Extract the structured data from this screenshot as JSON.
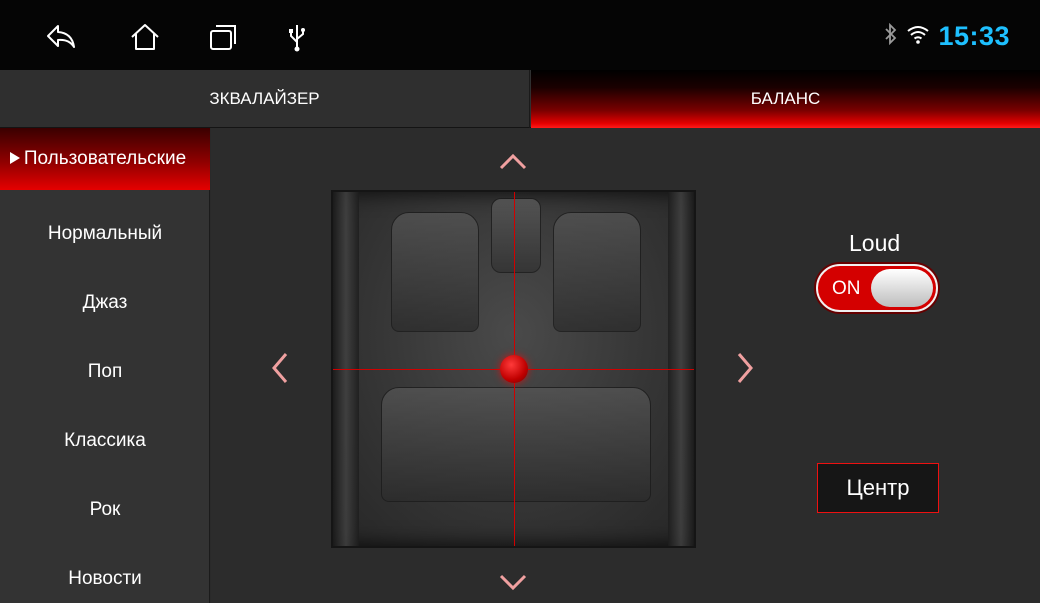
{
  "statusbar": {
    "nav_icons": [
      "back-icon",
      "home-icon",
      "recent-apps-icon",
      "usb-icon"
    ],
    "status_icons": [
      "bluetooth-icon",
      "wifi-icon"
    ],
    "time": "15:33",
    "time_color": "#1ec0ff"
  },
  "tabs": [
    {
      "label": "ЗКВАЛАЙЗЕР",
      "active": false
    },
    {
      "label": "БАЛАНС",
      "active": true
    }
  ],
  "presets": [
    {
      "label": "Пользовательские",
      "active": true
    },
    {
      "label": "Нормальный",
      "active": false
    },
    {
      "label": "Джаз",
      "active": false
    },
    {
      "label": "Поп",
      "active": false
    },
    {
      "label": "Классика",
      "active": false
    },
    {
      "label": "Рок",
      "active": false
    },
    {
      "label": "Новости",
      "active": false
    }
  ],
  "balance": {
    "arrows": [
      "chevron-up-icon",
      "chevron-down-icon",
      "chevron-left-icon",
      "chevron-right-icon"
    ],
    "fade": 0.5,
    "balance": 0.5,
    "accent_color": "#d00000"
  },
  "loud": {
    "label": "Loud",
    "state": "ON"
  },
  "center_button": {
    "label": "Центр"
  }
}
